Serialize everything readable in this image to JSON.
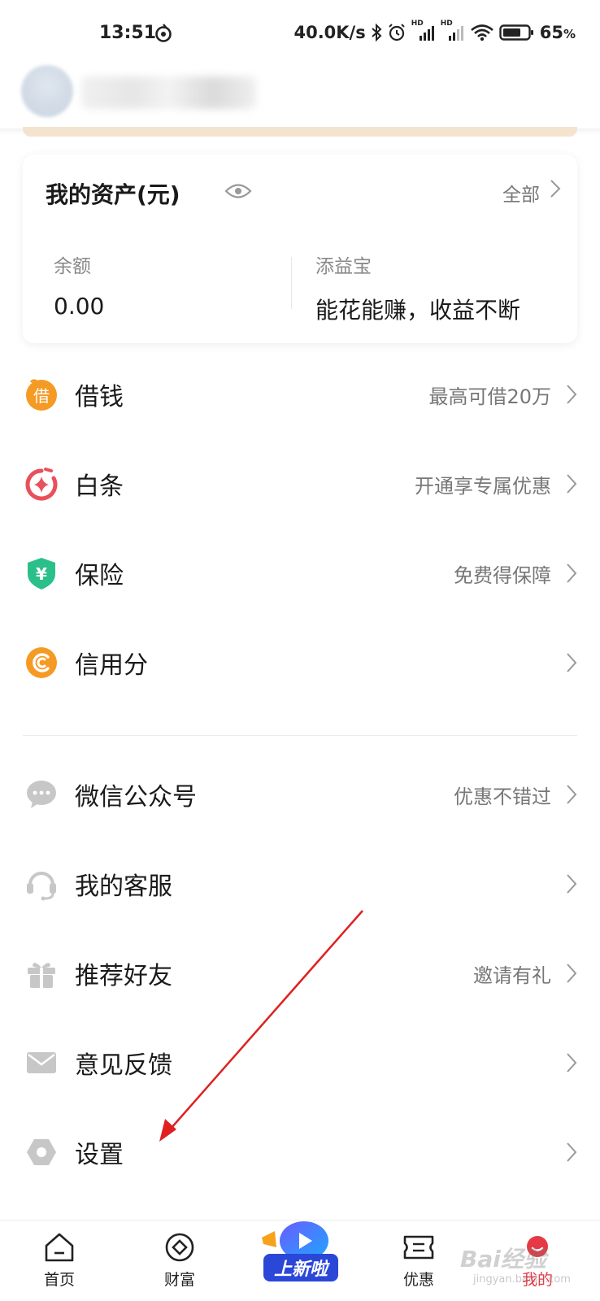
{
  "status_bar": {
    "time": "13:51",
    "net_speed": "40.0K/s",
    "battery": "65",
    "battery_unit": "%",
    "hd1": "HD",
    "hd2": "HD"
  },
  "assets": {
    "title": "我的资产(元)",
    "all_label": "全部",
    "balance_label": "余额",
    "balance_value": "0.00",
    "fund_label": "添益宝",
    "fund_desc": "能花能赚，收益不断"
  },
  "menu": [
    {
      "label": "借钱",
      "hint": "最高可借20万",
      "icon": "borrow-icon",
      "icon_text": "借"
    },
    {
      "label": "白条",
      "hint": "开通享专属优惠",
      "icon": "baitiao-icon"
    },
    {
      "label": "保险",
      "hint": "免费得保障",
      "icon": "insurance-shield-icon",
      "icon_text": "¥"
    },
    {
      "label": "信用分",
      "hint": "",
      "icon": "credit-score-icon"
    },
    {
      "label": "微信公众号",
      "hint": "优惠不错过",
      "icon": "wechat-chat-icon"
    },
    {
      "label": "我的客服",
      "hint": "",
      "icon": "headset-icon"
    },
    {
      "label": "推荐好友",
      "hint": "邀请有礼",
      "icon": "gift-icon"
    },
    {
      "label": "意见反馈",
      "hint": "",
      "icon": "mail-icon"
    },
    {
      "label": "设置",
      "hint": "",
      "icon": "settings-hexagon-icon"
    }
  ],
  "bottom_nav": [
    {
      "label": "首页",
      "icon": "home-icon"
    },
    {
      "label": "财富",
      "icon": "wealth-icon"
    },
    {
      "label": "优惠",
      "icon": "coupon-icon"
    },
    {
      "label": "我的",
      "icon": "profile-icon"
    }
  ],
  "promo_text": "上新啦",
  "watermark": "Bai经验",
  "watermark_sub": "jingyan.baidu.com",
  "colors": {
    "accent_red": "#e63946",
    "annotation_red": "#e02020",
    "borrow_orange": "#f59a23",
    "insurance_green": "#2bbf8a"
  }
}
